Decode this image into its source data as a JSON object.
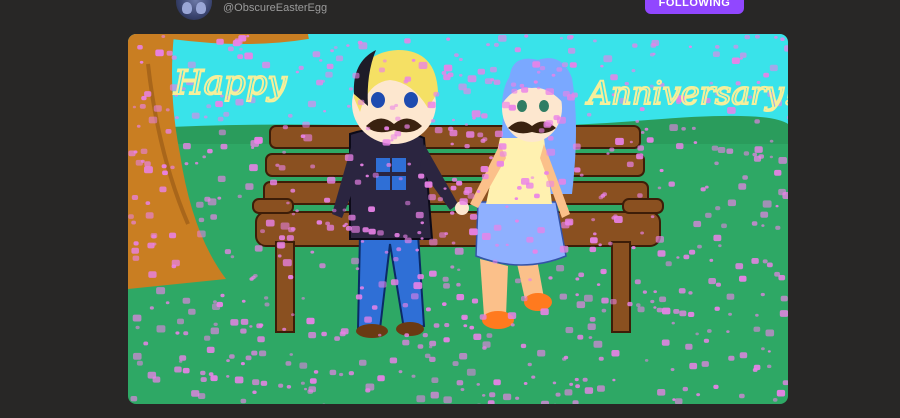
{
  "post": {
    "username": "@ObscureEasterEgg",
    "follow_label": "FOLLOWING"
  },
  "artwork": {
    "text_left": "Happy",
    "text_right": "Anniversary!",
    "colors": {
      "sky": "#39e3ea",
      "grass": "#2ea865",
      "bench": "#8a5020",
      "blossom": "#ea82e8",
      "text": "#f6ef9a"
    }
  }
}
